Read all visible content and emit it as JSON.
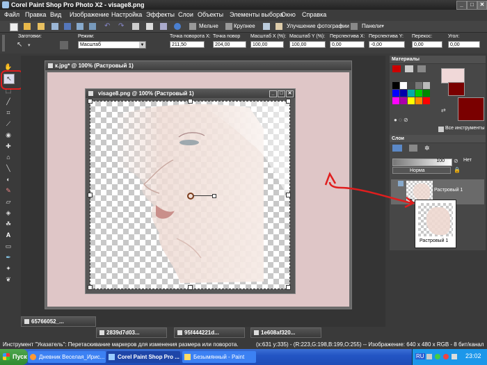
{
  "window": {
    "title": "Corel Paint Shop Pro Photo X2 - visage8.png",
    "min": "_",
    "max": "□",
    "close": "✕"
  },
  "menu": [
    "Файл",
    "Правка",
    "Вид",
    "Изображение",
    "Настройка",
    "Эффекты",
    "Слои",
    "Объекты",
    "Элементы выбора",
    "Окно",
    "Справка"
  ],
  "toolbar": {
    "smaller": "Мельче",
    "larger": "Крупнее",
    "enhance": "Улучшение фотографии",
    "panels": "Панели"
  },
  "options": {
    "presets_label": "Заготовки:",
    "mode_label": "Режим:",
    "mode_value": "Масштаб",
    "rot_x_label": "Точка поворота X:",
    "rot_x_value": "211,50",
    "rot_y_label": "Точка повор",
    "rot_y_value": "204,00",
    "scale_x_label": "Масштаб X (%):",
    "scale_x_value": "100,00",
    "scale_y_label": "Масштаб Y (%):",
    "scale_y_value": "100,00",
    "persp_x_label": "Перспектива X:",
    "persp_x_value": "0,00",
    "persp_y_label": "Перспектива Y:",
    "persp_y_value": "-0,00",
    "skew_label": "Перекос:",
    "skew_value": "0,00",
    "angle_label": "Угол:",
    "angle_value": "0,00"
  },
  "docs": {
    "back_title": "к.jpg* @ 100% (Растровый 1)",
    "front_title": "visage8.png @ 100% (Растровый 1)"
  },
  "minimized": [
    "65766052_...",
    "2839d7d03...",
    "95f444221d...",
    "1e608af320..."
  ],
  "materials": {
    "title": "Материалы",
    "all_tools": "Все инструменты"
  },
  "layers": {
    "title": "Слои",
    "opacity": "100",
    "none": "Нет",
    "blend": "Норма",
    "layer_name": "Растровый 1",
    "drag_label": "Растровый 1"
  },
  "status": {
    "left": "Инструмент \"Указатель\": Перетаскивание маркеров для изменения размера или поворота.",
    "right": "(x:631 y:335) - (R:223,G:198,B:199,O:255) -- Изображение: 640 x 480 x RGB - 8 бит/канал"
  },
  "taskbar": {
    "start": "Пуск",
    "tasks": [
      "Дневник Веселая_Ирис...",
      "Corel Paint Shop Pro ...",
      "Безымянный - Paint"
    ],
    "lang": "RU",
    "time": "23:02"
  },
  "colors": {
    "accent_red": "#e01e1e",
    "canvas_pink": "#dfc6c7",
    "dark_red": "#7a0000"
  }
}
